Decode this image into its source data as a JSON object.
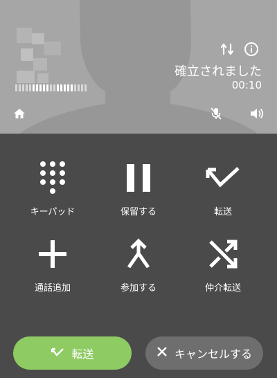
{
  "call": {
    "status": "確立されました",
    "timer": "00:10"
  },
  "icons": {
    "swap": "swap-audio-icon",
    "info": "info-icon",
    "home": "home-icon",
    "mute": "mic-off-icon",
    "speaker": "speaker-icon"
  },
  "actions": [
    {
      "label": "キーパッド",
      "icon": "dialpad-icon"
    },
    {
      "label": "保留する",
      "icon": "pause-icon"
    },
    {
      "label": "転送",
      "icon": "transfer-icon"
    },
    {
      "label": "通話追加",
      "icon": "plus-icon"
    },
    {
      "label": "参加する",
      "icon": "merge-icon"
    },
    {
      "label": "仲介転送",
      "icon": "shuffle-icon"
    }
  ],
  "buttons": {
    "transfer_label": "転送",
    "cancel_label": "キャンセルする"
  },
  "colors": {
    "header_bg": "#a9a9a9",
    "panel_bg": "#4a4a4a",
    "transfer_green": "#8ecb63",
    "cancel_gray": "#6e6e6e"
  }
}
